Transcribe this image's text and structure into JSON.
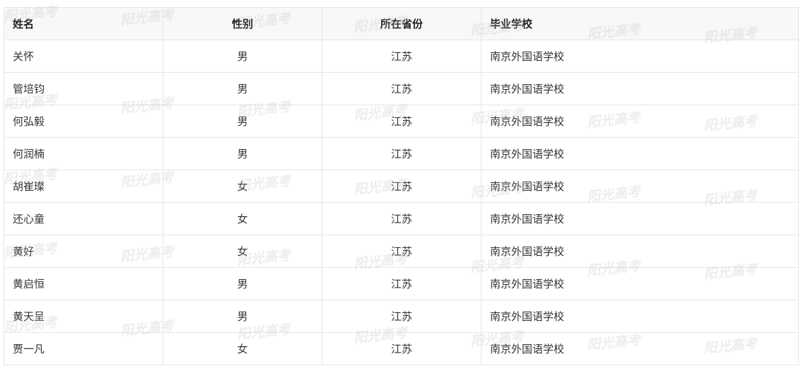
{
  "table": {
    "headers": {
      "name": "姓名",
      "gender": "性别",
      "province": "所在省份",
      "school": "毕业学校"
    },
    "rows": [
      {
        "name": "关怀",
        "gender": "男",
        "province": "江苏",
        "school": "南京外国语学校"
      },
      {
        "name": "管培钧",
        "gender": "男",
        "province": "江苏",
        "school": "南京外国语学校"
      },
      {
        "name": "何弘毅",
        "gender": "男",
        "province": "江苏",
        "school": "南京外国语学校"
      },
      {
        "name": "何润楠",
        "gender": "男",
        "province": "江苏",
        "school": "南京外国语学校"
      },
      {
        "name": "胡崔璨",
        "gender": "女",
        "province": "江苏",
        "school": "南京外国语学校"
      },
      {
        "name": "还心童",
        "gender": "女",
        "province": "江苏",
        "school": "南京外国语学校"
      },
      {
        "name": "黄好",
        "gender": "女",
        "province": "江苏",
        "school": "南京外国语学校"
      },
      {
        "name": "黄启恒",
        "gender": "男",
        "province": "江苏",
        "school": "南京外国语学校"
      },
      {
        "name": "黄天呈",
        "gender": "男",
        "province": "江苏",
        "school": "南京外国语学校"
      },
      {
        "name": "贾一凡",
        "gender": "女",
        "province": "江苏",
        "school": "南京外国语学校"
      }
    ]
  },
  "watermark": {
    "text": "阳光高考"
  }
}
